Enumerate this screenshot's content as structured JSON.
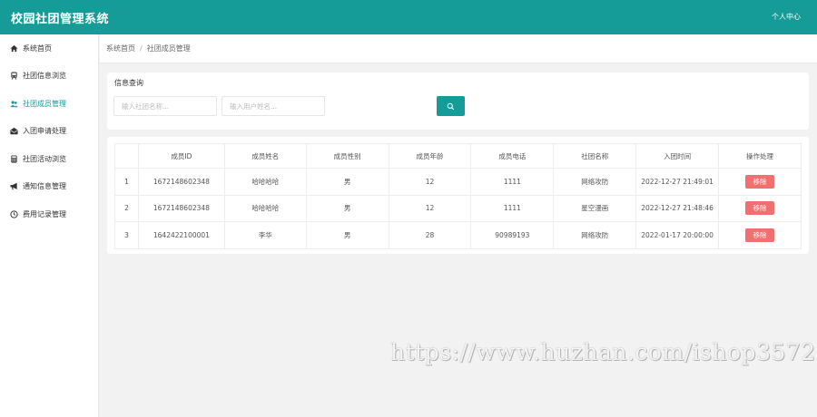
{
  "header": {
    "title": "校园社团管理系统",
    "user_center": "个人中心"
  },
  "sidebar": {
    "items": [
      {
        "label": "系统首页",
        "icon": "home-icon"
      },
      {
        "label": "社团信息浏览",
        "icon": "train-icon"
      },
      {
        "label": "社团成员管理",
        "icon": "users-icon",
        "active": true
      },
      {
        "label": "入团申请处理",
        "icon": "envelope-open-icon"
      },
      {
        "label": "社团活动浏览",
        "icon": "calculator-icon"
      },
      {
        "label": "通知信息管理",
        "icon": "bullhorn-icon"
      },
      {
        "label": "费用记录管理",
        "icon": "clock-icon"
      }
    ]
  },
  "breadcrumb": {
    "home": "系统首页",
    "separator": "/",
    "current": "社团成员管理"
  },
  "search": {
    "title": "信息查询",
    "club_placeholder": "输入社团名称...",
    "user_placeholder": "输入用户姓名..."
  },
  "table": {
    "columns": [
      "",
      "成员ID",
      "成员姓名",
      "成员性别",
      "成员年龄",
      "成员电话",
      "社团名称",
      "入团时间",
      "操作处理"
    ],
    "rows": [
      {
        "index": "1",
        "id": "1672148602348",
        "name": "哈哈哈哈",
        "gender": "男",
        "age": "12",
        "phone": "1111",
        "club": "网络攻防",
        "join_time": "2022-12-27 21:49:01",
        "action": "移除"
      },
      {
        "index": "2",
        "id": "1672148602348",
        "name": "哈哈哈哈",
        "gender": "男",
        "age": "12",
        "phone": "1111",
        "club": "星空漫画",
        "join_time": "2022-12-27 21:48:46",
        "action": "移除"
      },
      {
        "index": "3",
        "id": "1642422100001",
        "name": "李华",
        "gender": "男",
        "age": "28",
        "phone": "90989193",
        "club": "网络攻防",
        "join_time": "2022-01-17 20:00:00",
        "action": "移除"
      }
    ]
  },
  "watermark": "https://www.huzhan.com/ishop3572",
  "colors": {
    "primary": "#159b98",
    "danger": "#f07070",
    "background": "#f2f2f2"
  }
}
